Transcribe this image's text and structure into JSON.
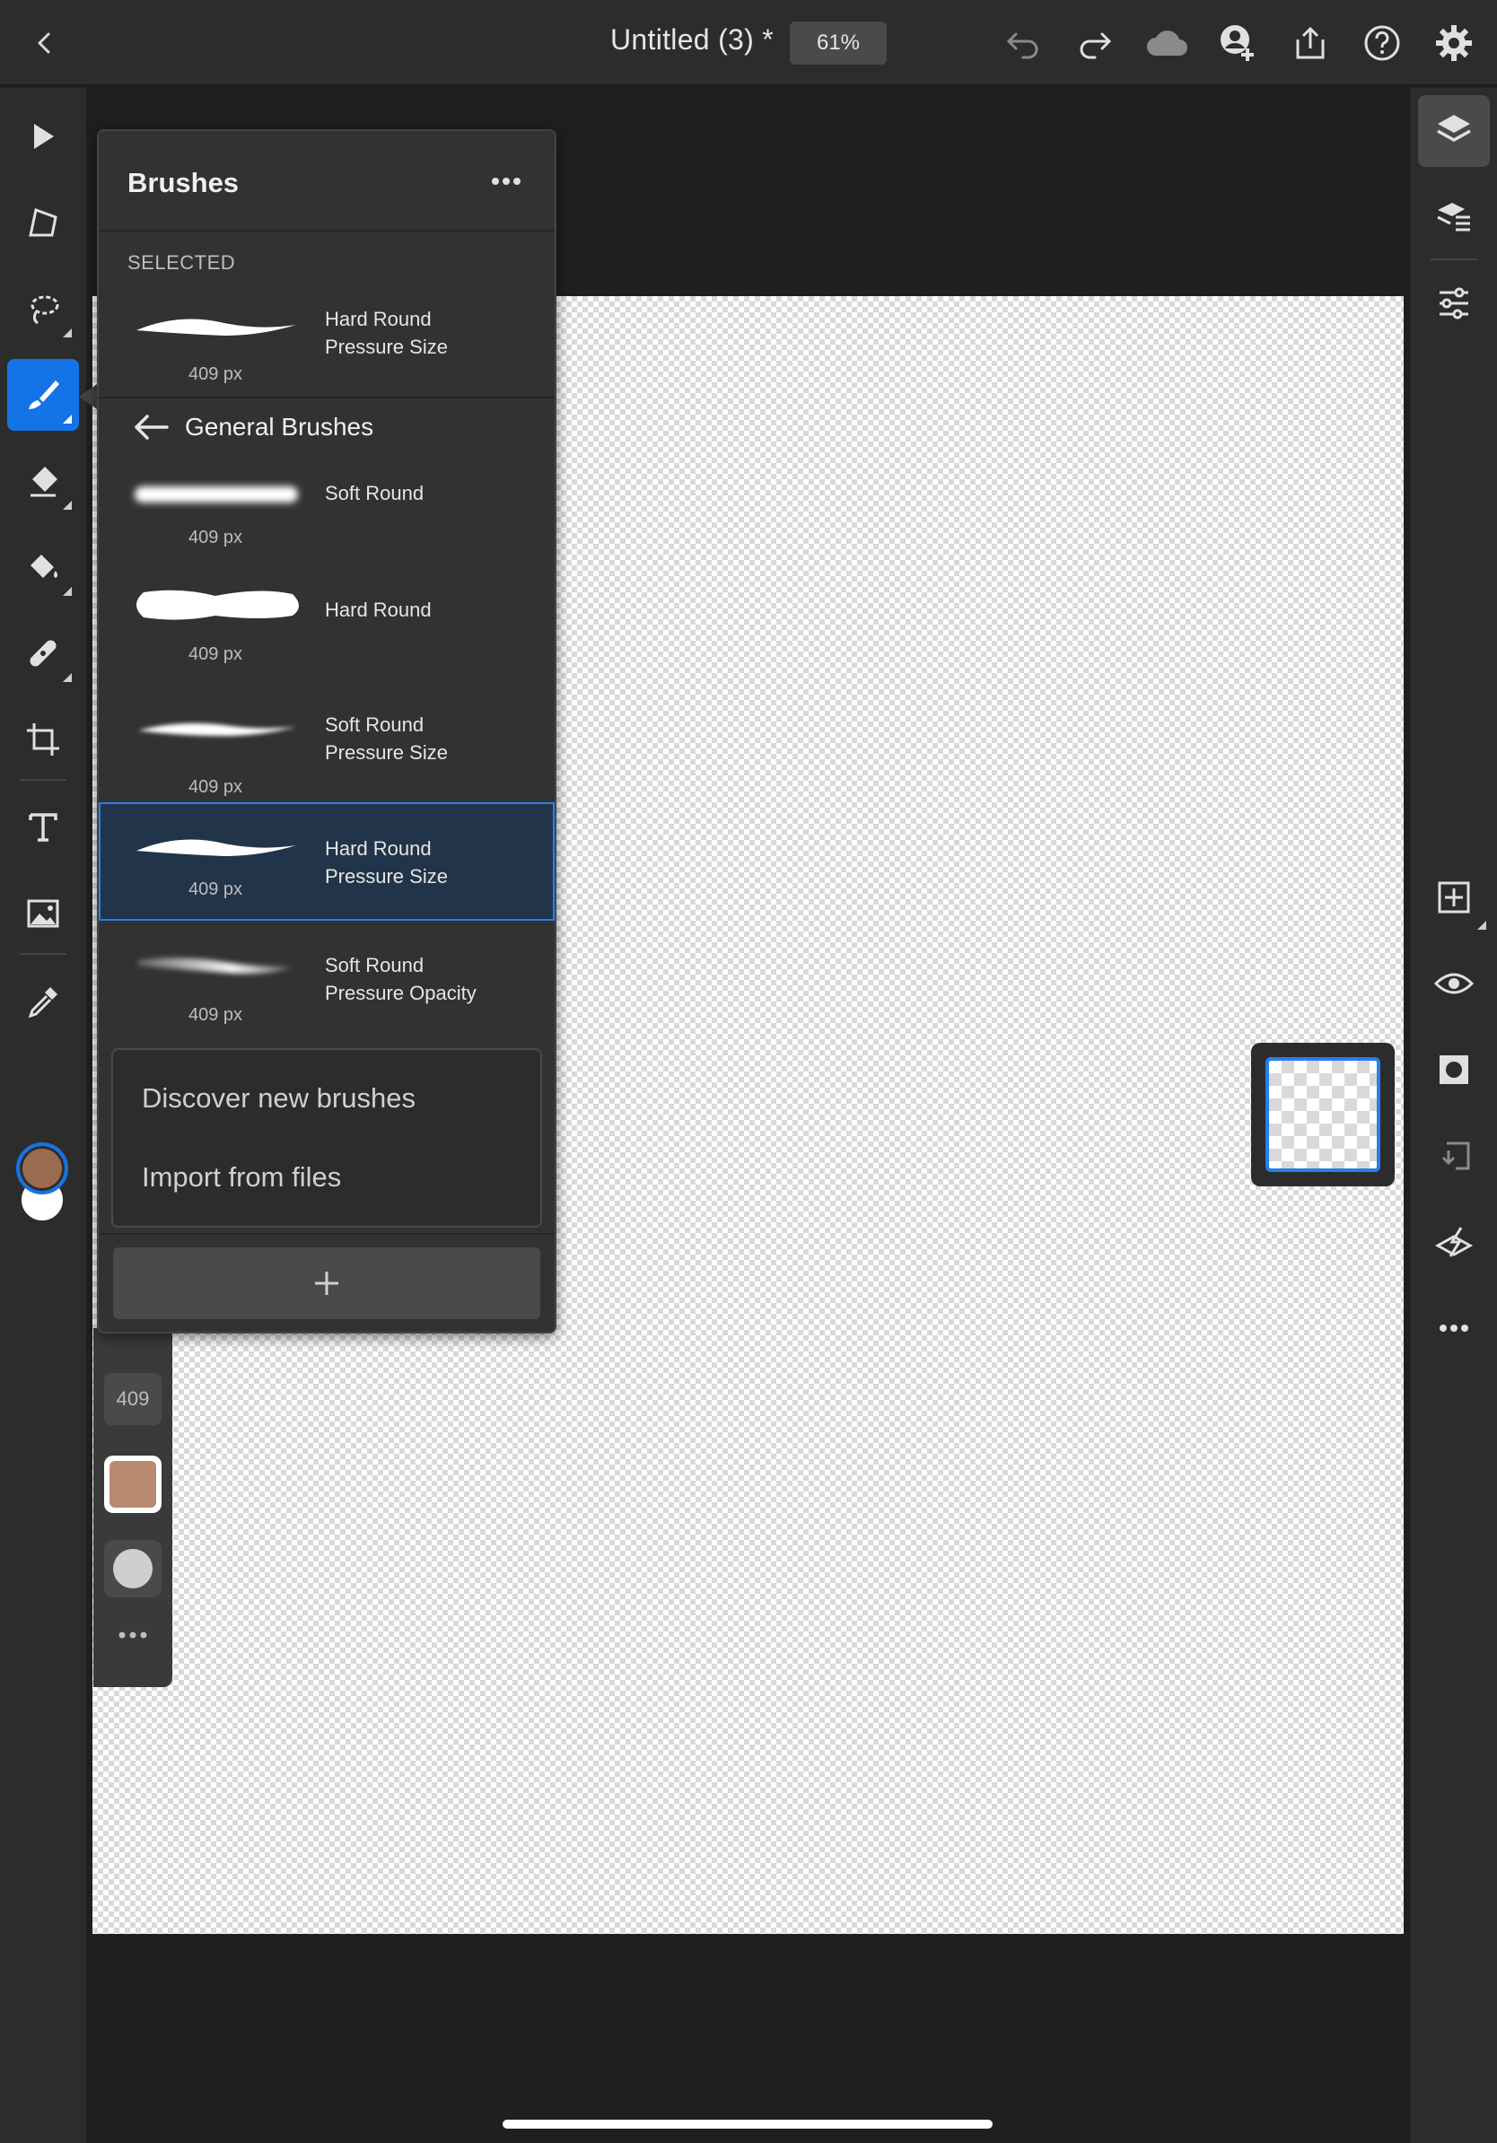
{
  "app": {
    "document_title": "Untitled (3) *",
    "zoom_level": "61%"
  },
  "brushes_panel": {
    "title": "Brushes",
    "selected_section_label": "SELECTED",
    "selected_brush": {
      "name_line1": "Hard Round",
      "name_line2": "Pressure Size",
      "size": "409 px"
    },
    "group_title": "General Brushes",
    "brushes": [
      {
        "name_line1": "Soft Round",
        "name_line2": "",
        "size": "409 px"
      },
      {
        "name_line1": "Hard Round",
        "name_line2": "",
        "size": "409 px"
      },
      {
        "name_line1": "Soft Round",
        "name_line2": "Pressure Size",
        "size": "409 px"
      },
      {
        "name_line1": "Hard Round",
        "name_line2": "Pressure Size",
        "size": "409 px"
      },
      {
        "name_line1": "Soft Round",
        "name_line2": "Pressure Opacity",
        "size": "409 px"
      }
    ],
    "menu": {
      "discover_label": "Discover new brushes",
      "import_label": "Import from files"
    },
    "add_label": "+"
  },
  "brush_properties": {
    "size_value": "409"
  },
  "colors": {
    "accent": "#1473e6",
    "foreground": "#9b6b50",
    "background": "#ffffff",
    "selected_row": "#213449"
  },
  "icons": {
    "top": [
      "chevron-left-icon",
      "undo-icon",
      "redo-icon",
      "cloud-icon",
      "invite-user-icon",
      "share-icon",
      "help-icon",
      "gear-icon"
    ],
    "left": [
      "select-arrow-icon",
      "transform-icon",
      "lasso-icon",
      "brush-icon",
      "eraser-icon",
      "fill-bucket-icon",
      "healing-icon",
      "crop-icon",
      "type-icon",
      "image-icon",
      "eyedropper-icon"
    ],
    "right": [
      "layers-icon",
      "layer-properties-icon",
      "adjustments-icon",
      "add-layer-icon",
      "visibility-icon",
      "mask-icon",
      "clipping-icon",
      "merge-icon",
      "more-icon"
    ]
  }
}
